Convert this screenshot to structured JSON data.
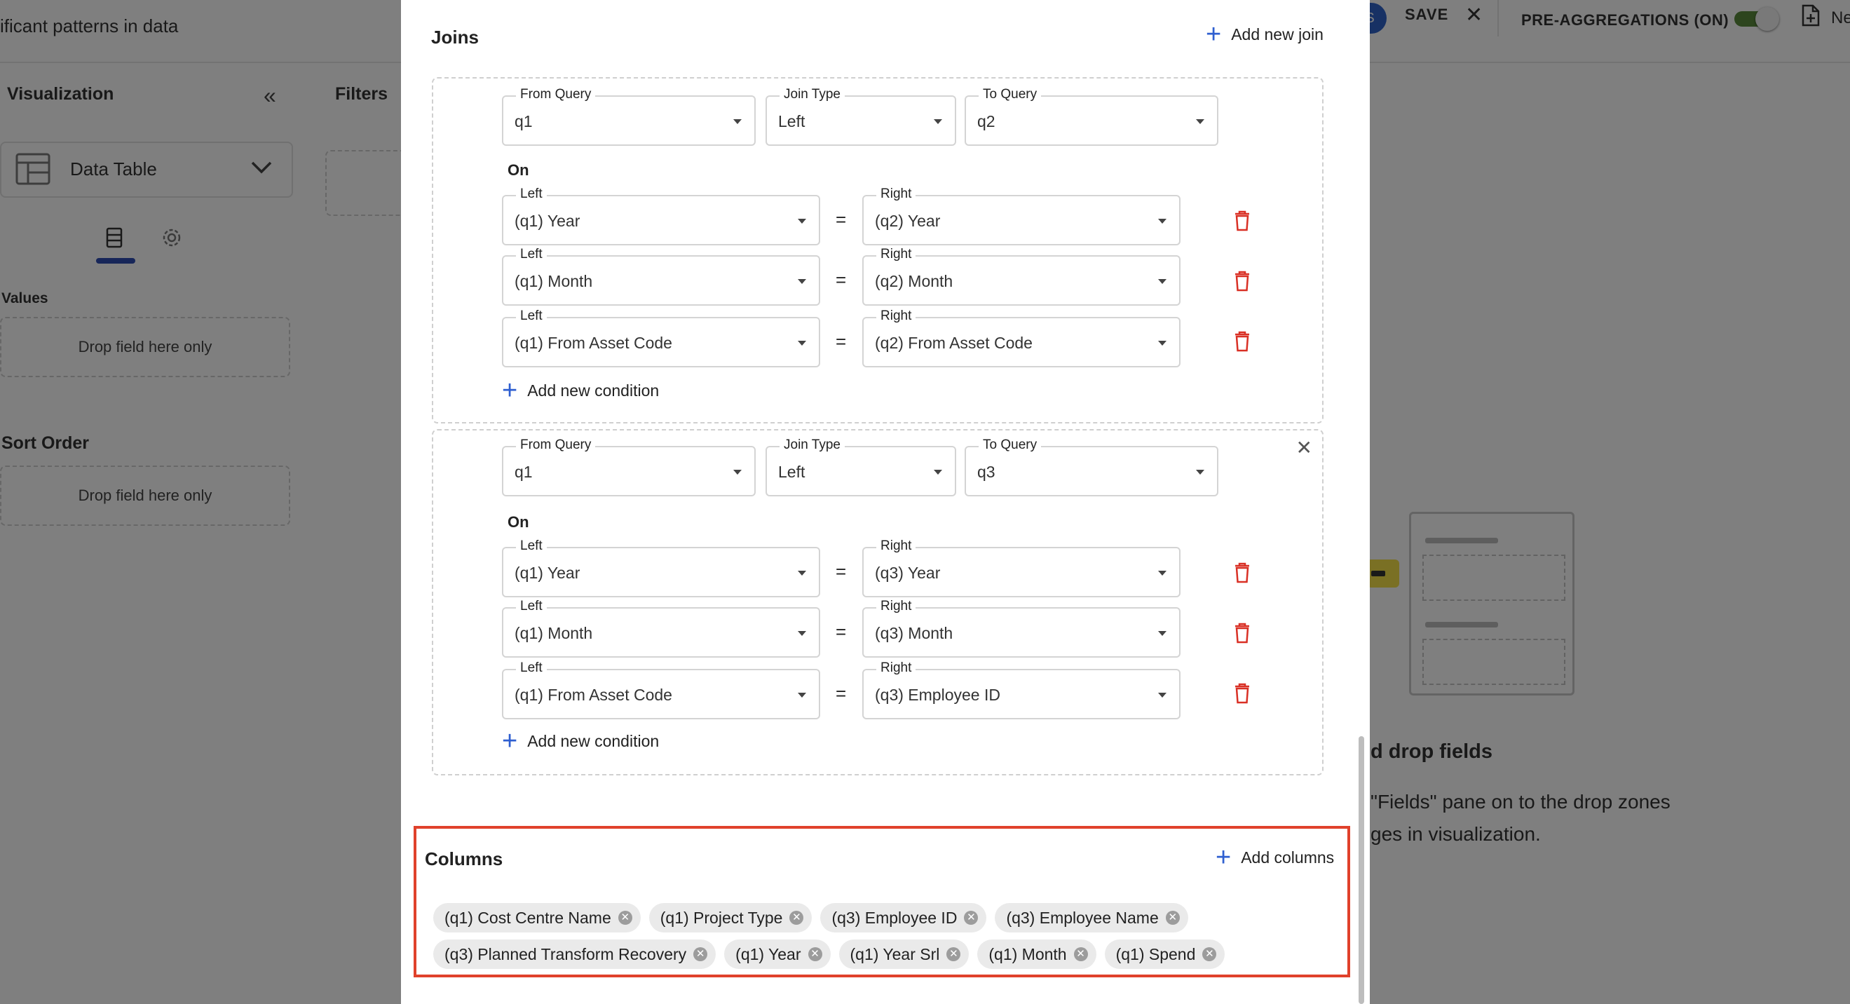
{
  "background": {
    "subtitle": "ificant patterns in data",
    "avatar_initial": "S",
    "save_label": "SAVE",
    "close_symbol": "✕",
    "preagg_label": "PRE-AGGREGATIONS (ON)",
    "new_label": "Ne",
    "visualization": {
      "title": "Visualization",
      "collapse_symbol": "«",
      "selected_type": "Data Table",
      "values_label": "Values",
      "values_drop": "Drop field here only",
      "sort_label": "Sort Order",
      "sort_drop": "Drop field here only"
    },
    "filters_title": "Filters",
    "canvas": {
      "title": "d drop fields",
      "line1": "\"Fields\" pane on to the drop zones",
      "line2": "ges in visualization."
    }
  },
  "modal": {
    "joins_title": "Joins",
    "add_join_label": "Add new join",
    "from_query_label": "From Query",
    "join_type_label": "Join Type",
    "to_query_label": "To Query",
    "on_label": "On",
    "left_label": "Left",
    "right_label": "Right",
    "equals": "=",
    "add_condition_label": "Add new condition",
    "joins": [
      {
        "from_query": "q1",
        "join_type": "Left",
        "to_query": "q2",
        "conditions": [
          {
            "left": "(q1) Year",
            "right": "(q2) Year"
          },
          {
            "left": "(q1) Month",
            "right": "(q2) Month"
          },
          {
            "left": "(q1) From Asset Code",
            "right": "(q2) From Asset Code"
          }
        ]
      },
      {
        "from_query": "q1",
        "join_type": "Left",
        "to_query": "q3",
        "conditions": [
          {
            "left": "(q1) Year",
            "right": "(q3) Year"
          },
          {
            "left": "(q1) Month",
            "right": "(q3) Month"
          },
          {
            "left": "(q1) From Asset Code",
            "right": "(q3) Employee ID"
          }
        ]
      }
    ],
    "columns_title": "Columns",
    "add_columns_label": "Add columns",
    "columns": [
      "(q1) Cost Centre Name",
      "(q1) Project Type",
      "(q3) Employee ID",
      "(q3) Employee Name",
      "(q3) Planned Transform Recovery",
      "(q1) Year",
      "(q1) Year Srl",
      "(q1) Month",
      "(q1) Spend"
    ]
  },
  "colors": {
    "accent": "#2f5fd0",
    "danger": "#d93025",
    "highlight": "#e0412b",
    "toggle_on": "#5a8a3c"
  }
}
